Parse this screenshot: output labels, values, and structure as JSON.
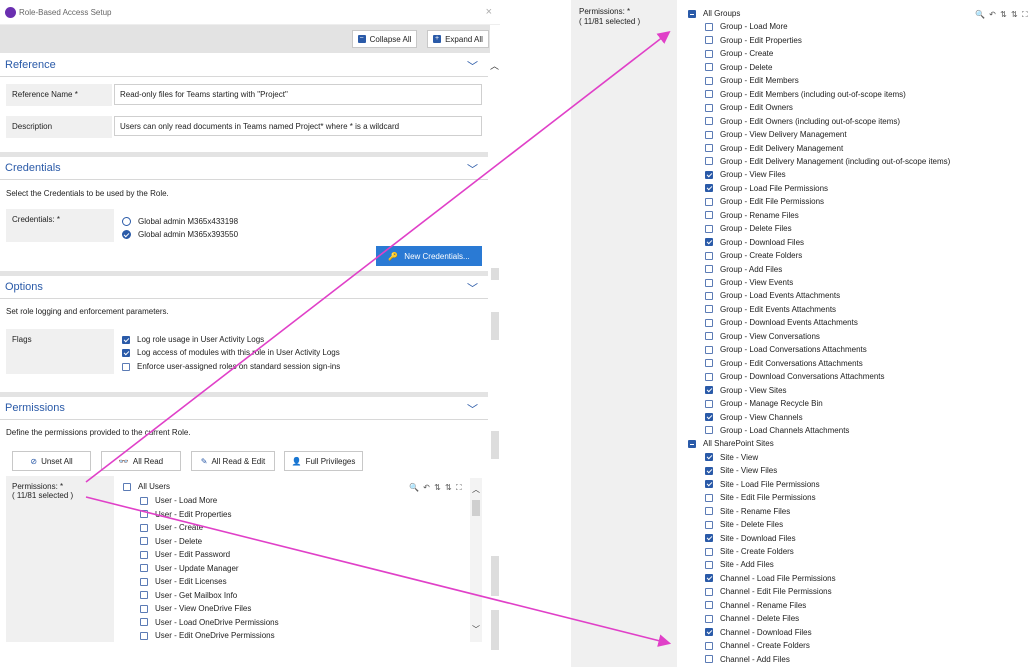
{
  "dialog": {
    "title": "Role-Based Access Setup",
    "close": "×"
  },
  "toolbar": {
    "collapse_all": "Collapse All",
    "expand_all": "Expand All"
  },
  "reference": {
    "title": "Reference",
    "name_label": "Reference Name *",
    "name_value": "Read-only files for Teams starting with \"Project\"",
    "desc_label": "Description",
    "desc_value": "Users can only read documents in Teams named Project* where * is a wildcard"
  },
  "credentials": {
    "title": "Credentials",
    "intro": "Select the Credentials to be used by the Role.",
    "label": "Credentials: *",
    "options": [
      {
        "label": "Global admin M365x433198",
        "selected": false
      },
      {
        "label": "Global admin M365x393550",
        "selected": true
      }
    ],
    "new_button": "New Credentials..."
  },
  "options": {
    "title": "Options",
    "intro": "Set role logging and enforcement parameters.",
    "flags_label": "Flags",
    "flags": [
      {
        "label": "Log role usage in User Activity Logs",
        "checked": true
      },
      {
        "label": "Log access of modules with this role in User Activity Logs",
        "checked": true
      },
      {
        "label": "Enforce user-assigned roles on standard session sign-ins",
        "checked": false
      }
    ]
  },
  "permissions": {
    "title": "Permissions",
    "intro": "Define the permissions provided to the current Role.",
    "buttons": {
      "unset_all": "Unset All",
      "all_read": "All Read",
      "all_read_edit": "All Read & Edit",
      "full": "Full Privileges"
    },
    "label": "Permissions: *",
    "count": "( 11/81 selected )",
    "tools": "🔍 ↶ ⇅ ⇅ ⛶",
    "group_all_users": "All Users",
    "user_items": [
      "User - Load More",
      "User - Edit Properties",
      "User - Create",
      "User - Delete",
      "User - Edit Password",
      "User - Update Manager",
      "User - Edit Licenses",
      "User - Get Mailbox Info",
      "User - View OneDrive Files",
      "User - Load OneDrive Permissions",
      "User - Edit OneDrive Permissions"
    ]
  },
  "right_panel": {
    "label": "Permissions: *",
    "count": "( 11/81 selected )",
    "tools": "🔍 ↶ ⇅ ⇅ ⛶",
    "group_all_groups": "All Groups",
    "group_items": [
      {
        "label": "Group - Load More",
        "checked": false
      },
      {
        "label": "Group - Edit Properties",
        "checked": false
      },
      {
        "label": "Group - Create",
        "checked": false
      },
      {
        "label": "Group - Delete",
        "checked": false
      },
      {
        "label": "Group - Edit Members",
        "checked": false
      },
      {
        "label": "Group - Edit Members (including out-of-scope items)",
        "checked": false
      },
      {
        "label": "Group - Edit Owners",
        "checked": false
      },
      {
        "label": "Group - Edit Owners (including out-of-scope items)",
        "checked": false
      },
      {
        "label": "Group - View Delivery Management",
        "checked": false
      },
      {
        "label": "Group - Edit Delivery Management",
        "checked": false
      },
      {
        "label": "Group - Edit Delivery Management (including out-of-scope items)",
        "checked": false
      },
      {
        "label": "Group - View Files",
        "checked": true
      },
      {
        "label": "Group - Load File Permissions",
        "checked": true
      },
      {
        "label": "Group - Edit File Permissions",
        "checked": false
      },
      {
        "label": "Group - Rename Files",
        "checked": false
      },
      {
        "label": "Group - Delete Files",
        "checked": false
      },
      {
        "label": "Group - Download Files",
        "checked": true
      },
      {
        "label": "Group - Create Folders",
        "checked": false
      },
      {
        "label": "Group - Add Files",
        "checked": false
      },
      {
        "label": "Group - View Events",
        "checked": false
      },
      {
        "label": "Group - Load Events Attachments",
        "checked": false
      },
      {
        "label": "Group - Edit Events Attachments",
        "checked": false
      },
      {
        "label": "Group - Download Events Attachments",
        "checked": false
      },
      {
        "label": "Group - View Conversations",
        "checked": false
      },
      {
        "label": "Group - Load Conversations Attachments",
        "checked": false
      },
      {
        "label": "Group - Edit Conversations Attachments",
        "checked": false
      },
      {
        "label": "Group - Download Conversations Attachments",
        "checked": false
      },
      {
        "label": "Group - View Sites",
        "checked": true
      },
      {
        "label": "Group - Manage Recycle Bin",
        "checked": false
      },
      {
        "label": "Group - View Channels",
        "checked": true
      },
      {
        "label": "Group - Load Channels Attachments",
        "checked": false
      }
    ],
    "group_all_sites": "All SharePoint Sites",
    "site_items": [
      {
        "label": "Site - View",
        "checked": true
      },
      {
        "label": "Site - View Files",
        "checked": true
      },
      {
        "label": "Site - Load File Permissions",
        "checked": true
      },
      {
        "label": "Site - Edit File Permissions",
        "checked": false
      },
      {
        "label": "Site - Rename Files",
        "checked": false
      },
      {
        "label": "Site - Delete Files",
        "checked": false
      },
      {
        "label": "Site - Download Files",
        "checked": true
      },
      {
        "label": "Site - Create Folders",
        "checked": false
      },
      {
        "label": "Site - Add Files",
        "checked": false
      },
      {
        "label": "Channel - Load File Permissions",
        "checked": true
      },
      {
        "label": "Channel - Edit File Permissions",
        "checked": false
      },
      {
        "label": "Channel - Rename Files",
        "checked": false
      },
      {
        "label": "Channel - Delete Files",
        "checked": false
      },
      {
        "label": "Channel - Download Files",
        "checked": true
      },
      {
        "label": "Channel - Create Folders",
        "checked": false
      },
      {
        "label": "Channel - Add Files",
        "checked": false
      }
    ]
  },
  "colors": {
    "accent": "#2a5aa8",
    "arrow": "#e040c8",
    "panel_gray": "#e3e3e3"
  }
}
